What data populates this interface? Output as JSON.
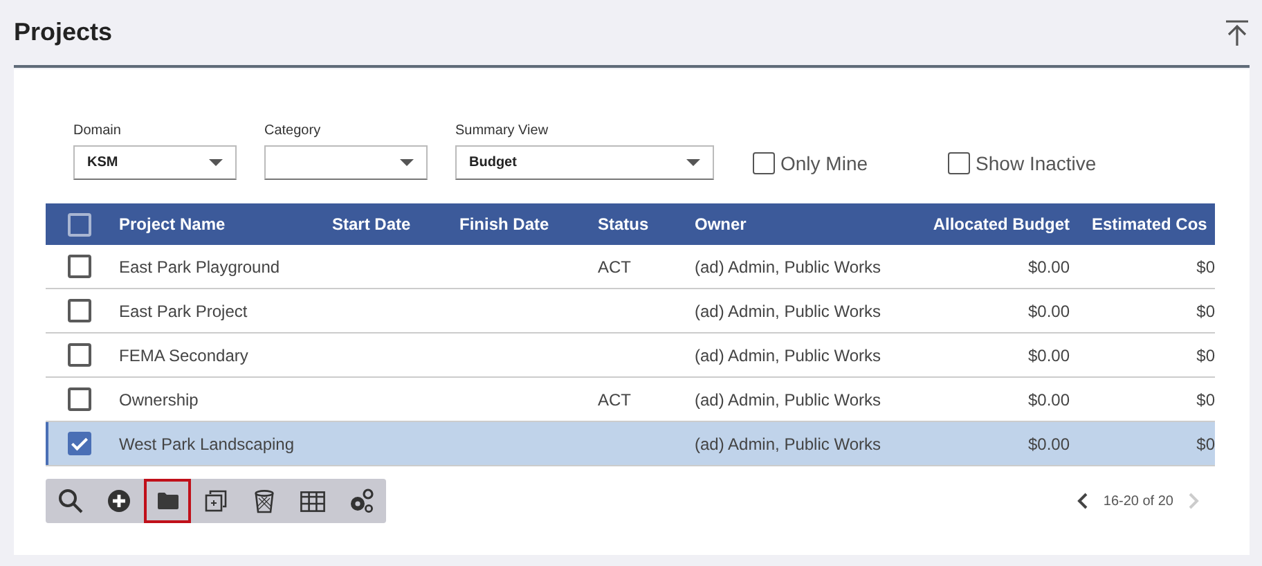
{
  "header": {
    "title": "Projects"
  },
  "filters": {
    "dropdowns": [
      {
        "label": "Domain",
        "value": "KSM"
      },
      {
        "label": "Category"
      },
      {
        "label": "Summary View",
        "value": "Budget"
      }
    ],
    "checkboxes": [
      {
        "label": "Only Mine",
        "checked": false
      },
      {
        "label": "Show Inactive",
        "checked": false
      }
    ]
  },
  "table": {
    "select_all_checked": false,
    "columns": [
      {
        "label": "Project Name"
      },
      {
        "label": "Start Date"
      },
      {
        "label": "Finish Date"
      },
      {
        "label": "Status"
      },
      {
        "label": "Owner"
      },
      {
        "label": "Allocated Budget"
      },
      {
        "label": "Estimated Cos"
      }
    ],
    "rows": [
      {
        "selected": false,
        "cells": [
          "East Park Playground",
          "",
          "",
          "ACT",
          "(ad) Admin, Public Works",
          "$0.00",
          "$0"
        ]
      },
      {
        "selected": false,
        "cells": [
          "East Park Project",
          "",
          "",
          "",
          "(ad) Admin, Public Works",
          "$0.00",
          "$0"
        ]
      },
      {
        "selected": false,
        "cells": [
          "FEMA Secondary",
          "",
          "",
          "",
          "(ad) Admin, Public Works",
          "$0.00",
          "$0"
        ]
      },
      {
        "selected": false,
        "cells": [
          "Ownership",
          "",
          "",
          "ACT",
          "(ad) Admin, Public Works",
          "$0.00",
          "$0"
        ]
      },
      {
        "selected": true,
        "cells": [
          "West Park Landscaping",
          "",
          "",
          "",
          "(ad) Admin, Public Works",
          "$0.00",
          "$0"
        ]
      }
    ]
  },
  "toolbar": [
    {
      "kind": "search",
      "selected": false
    },
    {
      "kind": "add",
      "selected": false
    },
    {
      "kind": "folder",
      "selected": true
    },
    {
      "kind": "copy",
      "selected": false
    },
    {
      "kind": "delete",
      "selected": false
    },
    {
      "kind": "columns",
      "selected": false
    },
    {
      "kind": "settings",
      "selected": false
    }
  ],
  "pager": {
    "range": "16-20 of 20",
    "prev_disabled": false,
    "next_disabled": true
  }
}
